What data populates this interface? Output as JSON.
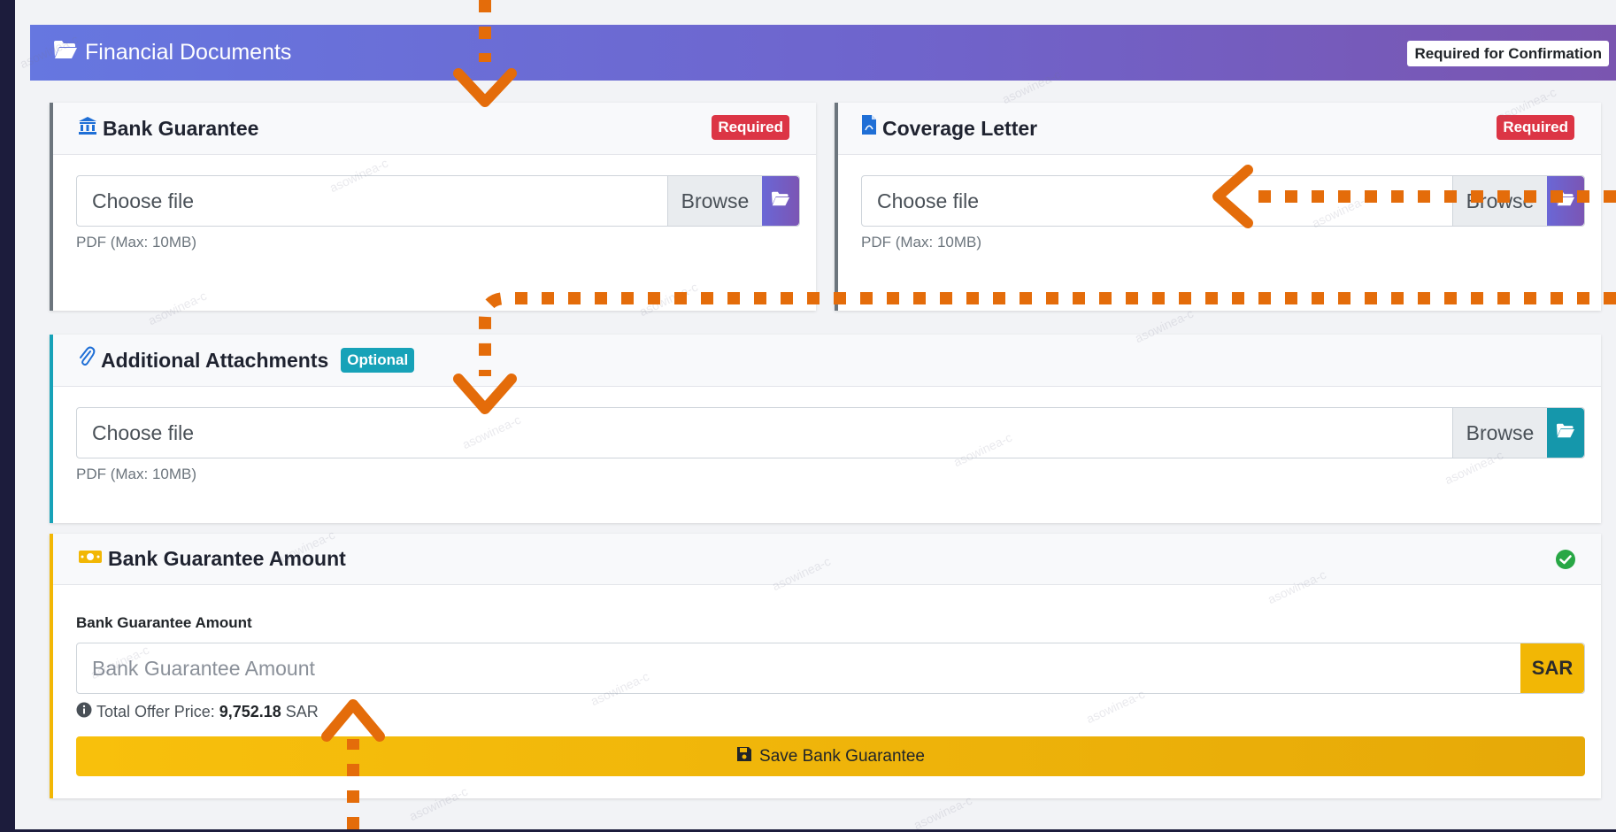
{
  "header": {
    "title": "Financial Documents",
    "badge": "Required for Confirmation",
    "icon": "folder-open-icon"
  },
  "bank_guarantee": {
    "title": "Bank Guarantee",
    "badge": "Required",
    "file_placeholder": "Choose file",
    "browse_label": "Browse",
    "hint": "PDF (Max: 10MB)",
    "icon": "bank-icon"
  },
  "coverage_letter": {
    "title": "Coverage Letter",
    "badge": "Required",
    "file_placeholder": "Choose file",
    "browse_label": "Browse",
    "hint": "PDF (Max: 10MB)",
    "icon": "pdf-file-icon"
  },
  "additional": {
    "title": "Additional Attachments",
    "badge": "Optional",
    "file_placeholder": "Choose file",
    "browse_label": "Browse",
    "hint": "PDF (Max: 10MB)",
    "icon": "paperclip-icon"
  },
  "amount": {
    "title": "Bank Guarantee Amount",
    "field_label": "Bank Guarantee Amount",
    "placeholder": "Bank Guarantee Amount",
    "currency": "SAR",
    "total_label": "Total Offer Price:",
    "total_value": "9,752.18",
    "total_currency": "SAR",
    "save_label": "Save Bank Guarantee",
    "status_icon": "check-circle-icon",
    "icon": "money-icon"
  },
  "watermark_text": "asowinea-c",
  "colors": {
    "accent_orange": "#e46c0a",
    "required_red": "#dc3545",
    "optional_cyan": "#17a2b8",
    "amount_yellow": "#f2b705",
    "success_green": "#28a745",
    "header_gradient_start": "#6677e0",
    "header_gradient_end": "#7a55b0"
  }
}
